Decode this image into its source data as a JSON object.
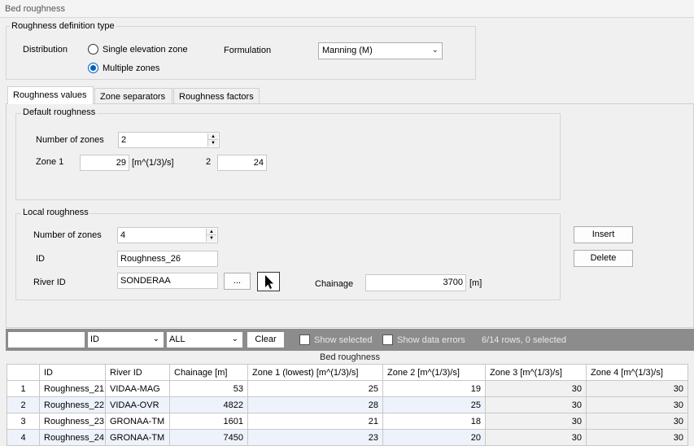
{
  "window": {
    "title": "Bed roughness"
  },
  "definition": {
    "group_title": "Roughness definition type",
    "distribution_label": "Distribution",
    "option_single": "Single elevation zone",
    "option_multiple": "Multiple zones",
    "selected": "Multiple zones",
    "formulation_label": "Formulation",
    "formulation_value": "Manning (M)"
  },
  "tabs": [
    {
      "label": "Roughness values",
      "active": true
    },
    {
      "label": "Zone separators",
      "active": false
    },
    {
      "label": "Roughness factors",
      "active": false
    }
  ],
  "default_roughness": {
    "group_title": "Default roughness",
    "zones_label": "Number of zones",
    "zones_value": "2",
    "zone1_label": "Zone 1",
    "zone1_value": "29",
    "unit": "[m^(1/3)/s]",
    "zone2_label": "2",
    "zone2_value": "24"
  },
  "local_roughness": {
    "group_title": "Local roughness",
    "zones_label": "Number of zones",
    "zones_value": "4",
    "id_label": "ID",
    "id_value": "Roughness_26",
    "river_label": "River ID",
    "river_value": "SONDERAA",
    "browse_label": "...",
    "chainage_label": "Chainage",
    "chainage_value": "3700",
    "chainage_unit": "[m]",
    "insert_label": "Insert",
    "delete_label": "Delete"
  },
  "toolbar": {
    "search_value": "",
    "field_value": "ID",
    "filter_value": "ALL",
    "clear_label": "Clear",
    "show_selected_label": "Show selected",
    "show_errors_label": "Show data errors",
    "row_status": "6/14 rows, 0 selected"
  },
  "table": {
    "band_title": "Bed roughness",
    "columns": [
      "",
      "ID",
      "River ID",
      "Chainage [m]",
      "Zone 1 (lowest) [m^(1/3)/s]",
      "Zone 2 [m^(1/3)/s]",
      "Zone 3 [m^(1/3)/s]",
      "Zone 4 [m^(1/3)/s]"
    ],
    "rows": [
      [
        "1",
        "Roughness_21",
        "VIDAA-MAG",
        "53",
        "25",
        "19",
        "30",
        "30"
      ],
      [
        "2",
        "Roughness_22",
        "VIDAA-OVR",
        "4822",
        "28",
        "25",
        "30",
        "30"
      ],
      [
        "3",
        "Roughness_23",
        "GRONAA-TM",
        "1601",
        "21",
        "18",
        "30",
        "30"
      ],
      [
        "4",
        "Roughness_24",
        "GRONAA-TM",
        "7450",
        "23",
        "20",
        "30",
        "30"
      ]
    ]
  }
}
